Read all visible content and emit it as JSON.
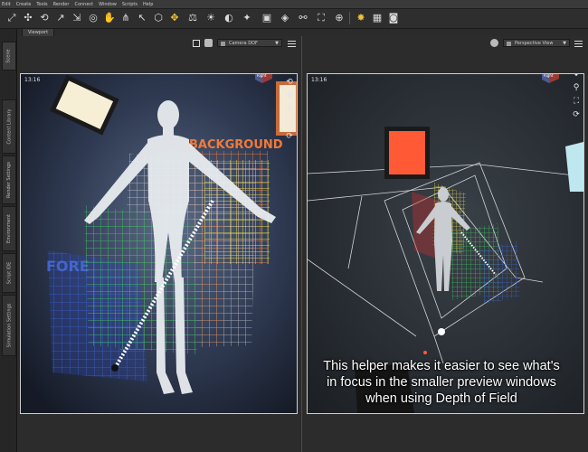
{
  "menu": [
    "Edit",
    "Create",
    "Tools",
    "Render",
    "Connect",
    "Window",
    "Scripts",
    "Help"
  ],
  "toolbar_icons": [
    "node-selection-icon",
    "universal-tool-icon",
    "rotate-icon",
    "translate-icon",
    "scale-icon",
    "spot-render-icon",
    "pose-tool-icon",
    "joint-editor-icon",
    "surface-selection-icon",
    "geometry-editor-icon",
    "morph-tool-icon",
    "node-weight-icon",
    "light-icon",
    "camera-icon",
    "figure-icon",
    "tool-settings-icon",
    "render-icon",
    "render-settings-icon",
    "scene-icon"
  ],
  "left_tabs": [
    "Scene",
    "Content Library",
    "Render Settings",
    "Environment",
    "Script IDE",
    "Simulation Settings"
  ],
  "viewport_tab": "Viewport",
  "left_pane": {
    "camera_select": "Camera DOF",
    "time": "13:16",
    "cube_label": "Right"
  },
  "right_pane": {
    "camera_select": "Perspective View",
    "time": "13:16",
    "cube_label": "Right"
  },
  "scene_text": {
    "background": "BACKGROUND",
    "foreground": "FORE"
  },
  "caption": {
    "line1": "This helper makes it easier to see what's",
    "line2": "in focus in the smaller preview windows",
    "line3": "when using Depth of Field"
  },
  "colors": {
    "grid_white": "#d8d8d8",
    "grid_yellow": "#e7d84a",
    "grid_orange": "#f07a3a",
    "grid_green": "#3fbf62",
    "grid_blue": "#3c66d8",
    "accent_red": "#ff5a35"
  }
}
